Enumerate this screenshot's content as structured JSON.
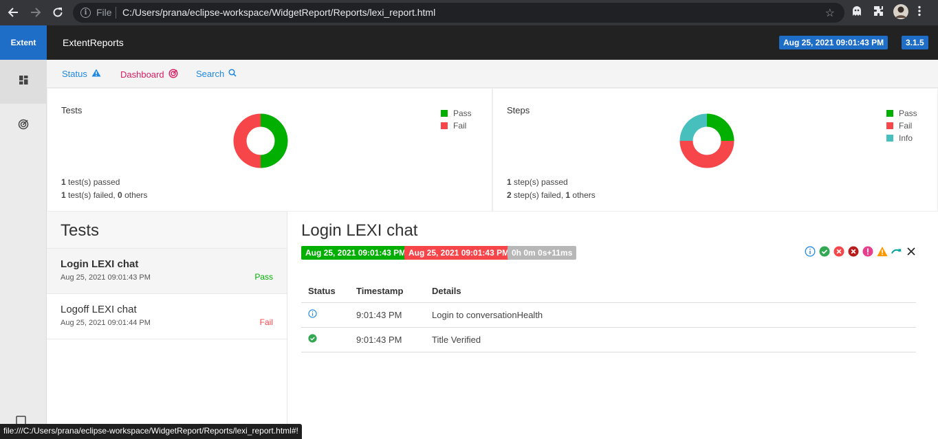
{
  "browser": {
    "scheme_label": "File",
    "url": "C:/Users/prana/eclipse-workspace/WidgetReport/Reports/lexi_report.html",
    "status_url": "file:///C:/Users/prana/eclipse-workspace/WidgetReport/Reports/lexi_report.html#!"
  },
  "sidebar": {
    "brand": "Extent"
  },
  "appbar": {
    "title": "ExtentReports",
    "date": "Aug 25, 2021 09:01:43 PM",
    "version": "3.1.5"
  },
  "subnav": {
    "status": "Status",
    "dashboard": "Dashboard",
    "search": "Search"
  },
  "colors": {
    "pass": "#00af00",
    "fail": "#f7464a",
    "info": "#46bfbd",
    "accent": "#1e6ec8"
  },
  "tests_card": {
    "title": "Tests",
    "legend": [
      "Pass",
      "Fail"
    ],
    "line1_count": "1",
    "line1_text": " test(s) passed",
    "line2_count": "1",
    "line2_text": " test(s) failed, ",
    "line2_others": "0",
    "line2_suffix": " others",
    "chart_data": {
      "type": "pie",
      "categories": [
        "Pass",
        "Fail"
      ],
      "values": [
        1,
        1
      ]
    }
  },
  "steps_card": {
    "title": "Steps",
    "legend": [
      "Pass",
      "Fail",
      "Info"
    ],
    "line1_count": "1",
    "line1_text": " step(s) passed",
    "line2_count": "2",
    "line2_text": " step(s) failed, ",
    "line2_others": "1",
    "line2_suffix": " others",
    "chart_data": {
      "type": "pie",
      "categories": [
        "Pass",
        "Fail",
        "Info"
      ],
      "values": [
        1,
        2,
        1
      ]
    }
  },
  "tests_list": {
    "header": "Tests",
    "items": [
      {
        "name": "Login LEXI chat",
        "time": "Aug 25, 2021 09:01:43 PM",
        "status": "Pass"
      },
      {
        "name": "Logoff LEXI chat",
        "time": "Aug 25, 2021 09:01:44 PM",
        "status": "Fail"
      }
    ]
  },
  "detail": {
    "title": "Login LEXI chat",
    "start": "Aug 25, 2021 09:01:43 PM",
    "end": "Aug 25, 2021 09:01:43 PM",
    "duration": "0h 0m 0s+11ms",
    "columns": [
      "Status",
      "Timestamp",
      "Details"
    ],
    "rows": [
      {
        "status": "info",
        "timestamp": "9:01:43 PM",
        "details": "Login to conversationHealth"
      },
      {
        "status": "pass",
        "timestamp": "9:01:43 PM",
        "details": "Title Verified"
      }
    ]
  }
}
